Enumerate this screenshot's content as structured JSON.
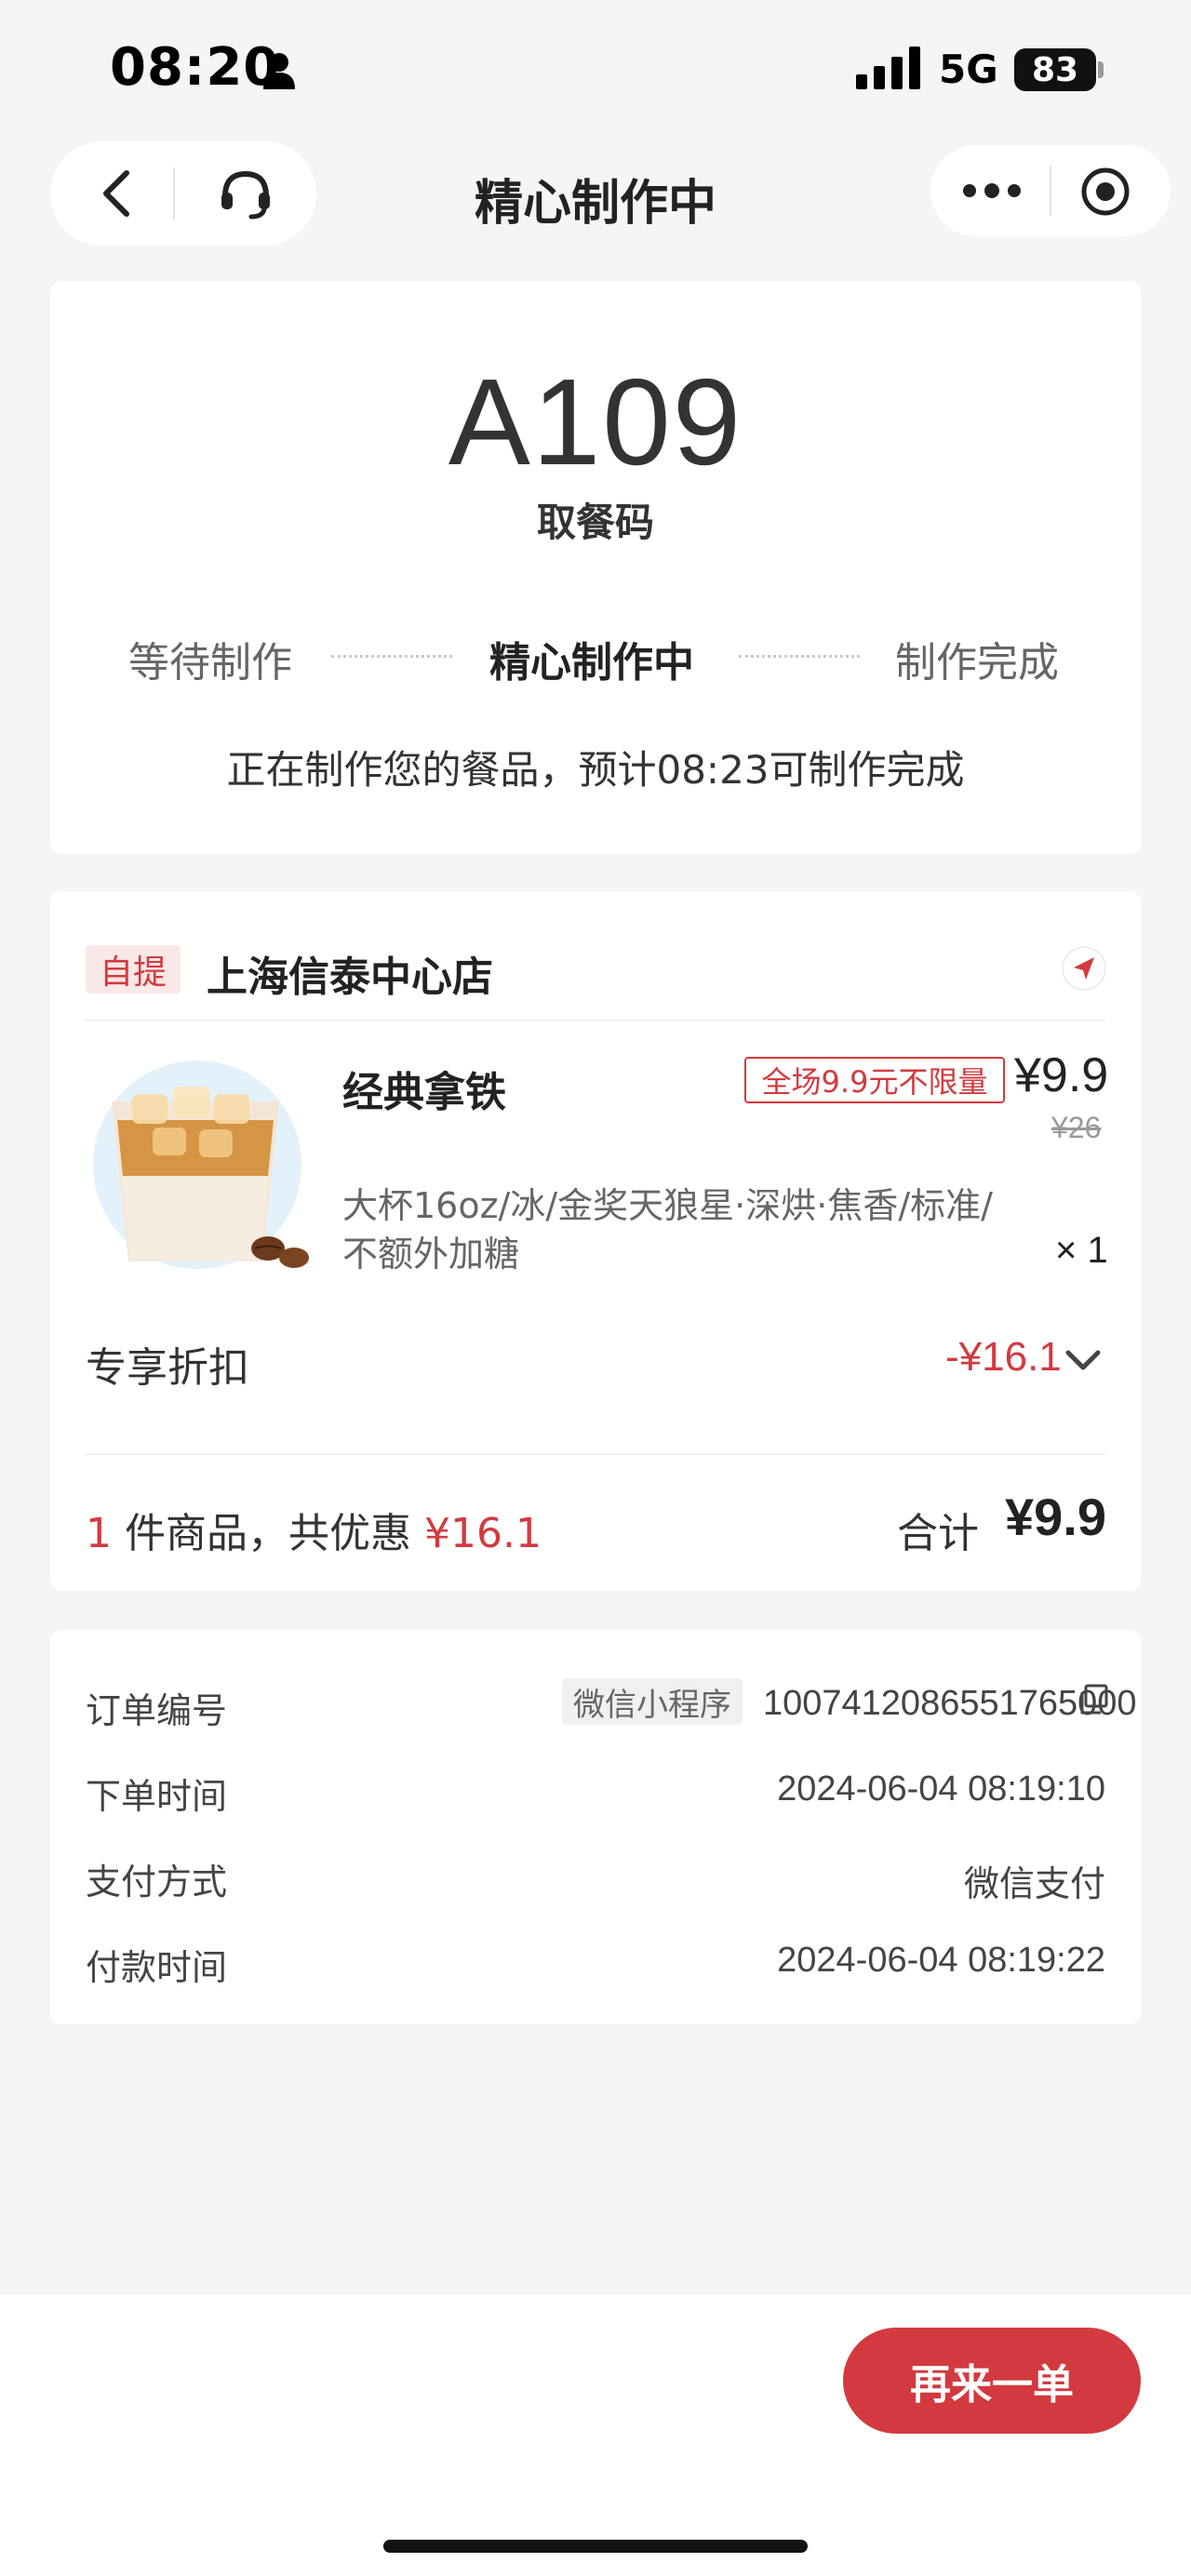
{
  "status_bar": {
    "time": "08:20",
    "network": "5G",
    "battery": "83"
  },
  "nav": {
    "title": "精心制作中"
  },
  "pickup": {
    "code": "A109",
    "code_label": "取餐码",
    "steps": [
      {
        "label": "等待制作",
        "active": false
      },
      {
        "label": "精心制作中",
        "active": true
      },
      {
        "label": "制作完成",
        "active": false
      }
    ],
    "note": "正在制作您的餐品，预计08:23可制作完成"
  },
  "order": {
    "pickup_tag": "自提",
    "store_name": "上海信泰中心店",
    "product": {
      "name": "经典拿铁",
      "promo_tag": "全场9.9元不限量",
      "price": "¥9.9",
      "original_price": "¥26",
      "spec": "大杯16oz/冰/金奖天狼星·深烘·焦香/标准/不额外加糖",
      "quantity": "× 1"
    },
    "discount": {
      "label": "专享折扣",
      "value": "-¥16.1"
    },
    "summary": {
      "count": "1",
      "count_suffix": "件商品，共优惠",
      "saved": "¥16.1",
      "total_label": "合计",
      "total": "¥9.9"
    }
  },
  "info": {
    "order_no_label": "订单编号",
    "channel": "微信小程序",
    "order_no": "1007412086551765000",
    "order_time_label": "下单时间",
    "order_time": "2024-06-04 08:19:10",
    "pay_method_label": "支付方式",
    "pay_method": "微信支付",
    "pay_time_label": "付款时间",
    "pay_time": "2024-06-04 08:19:22"
  },
  "footer": {
    "reorder_label": "再来一单"
  },
  "colors": {
    "accent": "#d23a3f",
    "background": "#f4f5f7"
  }
}
